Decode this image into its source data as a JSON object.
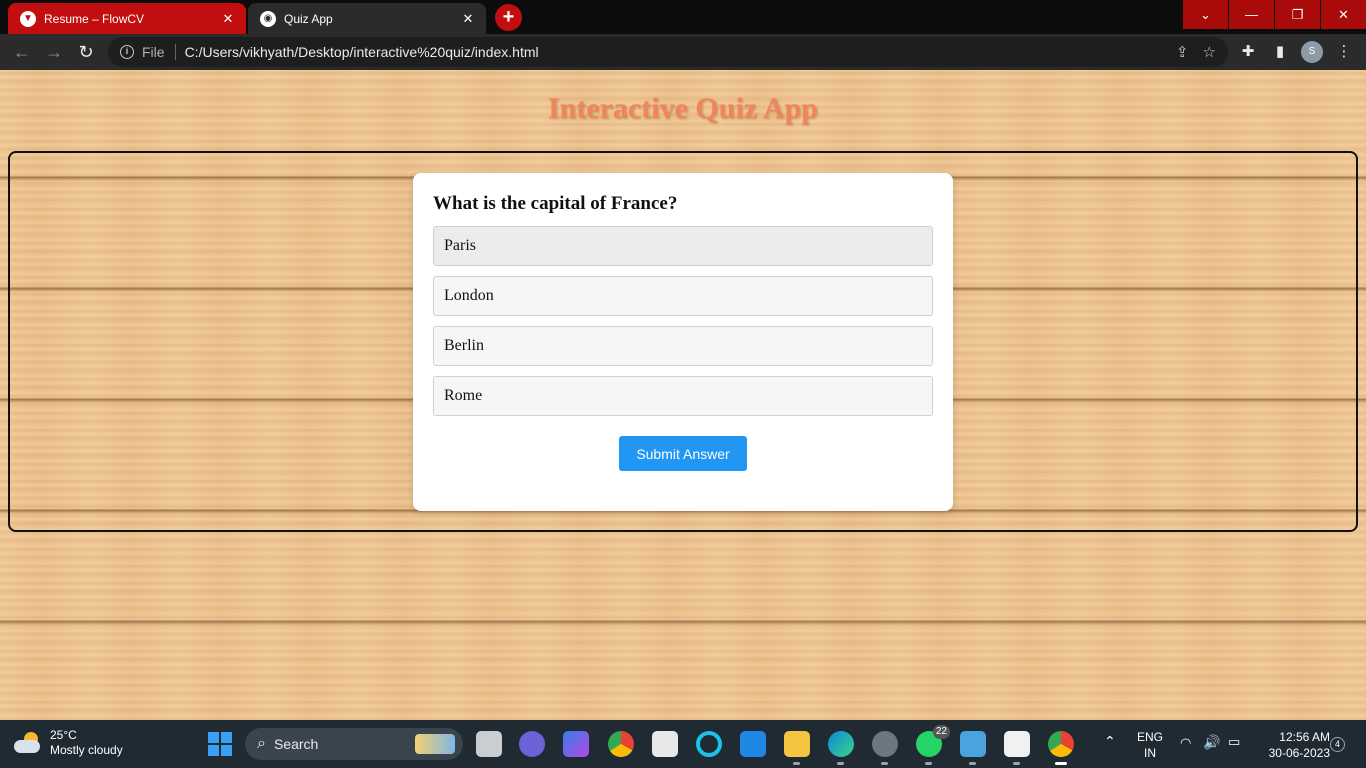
{
  "browser": {
    "tabs": [
      {
        "title": "Resume – FlowCV",
        "active": false
      },
      {
        "title": "Quiz App",
        "active": true
      }
    ],
    "new_tab": "+",
    "close_glyph": "✕",
    "window_controls": [
      "⌄",
      "—",
      "❐",
      "✕"
    ],
    "file_label": "File",
    "url": "C:/Users/vikhyath/Desktop/interactive%20quiz/index.html",
    "profile_initial": "S"
  },
  "page": {
    "title": "Interactive Quiz App",
    "question": "What is the capital of France?",
    "options": [
      "Paris",
      "London",
      "Berlin",
      "Rome"
    ],
    "submit_label": "Submit Answer",
    "colors": {
      "title": "#f0845b",
      "submit": "#2196f3"
    }
  },
  "taskbar": {
    "weather_temp": "25°C",
    "weather_desc": "Mostly cloudy",
    "search_label": "Search",
    "whatsapp_badge": "22",
    "lang_top": "ENG",
    "lang_bottom": "IN",
    "time": "12:56 AM",
    "date": "30-06-2023",
    "notification_count": "4"
  }
}
